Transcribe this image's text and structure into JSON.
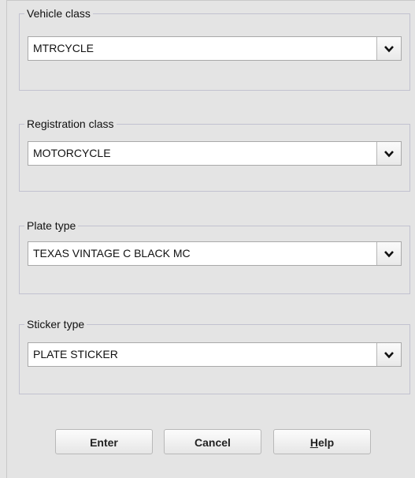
{
  "groups": [
    {
      "legend": "Vehicle class",
      "value": "MTRCYCLE"
    },
    {
      "legend": "Registration class",
      "value": "MOTORCYCLE"
    },
    {
      "legend": "Plate type",
      "value": "TEXAS VINTAGE C BLACK MC"
    },
    {
      "legend": "Sticker type",
      "value": "PLATE STICKER"
    }
  ],
  "buttons": {
    "enter": "Enter",
    "cancel": "Cancel",
    "help_mnemonic": "H",
    "help_rest": "elp"
  },
  "icons": {
    "dropdown": "chevron-down-icon"
  }
}
